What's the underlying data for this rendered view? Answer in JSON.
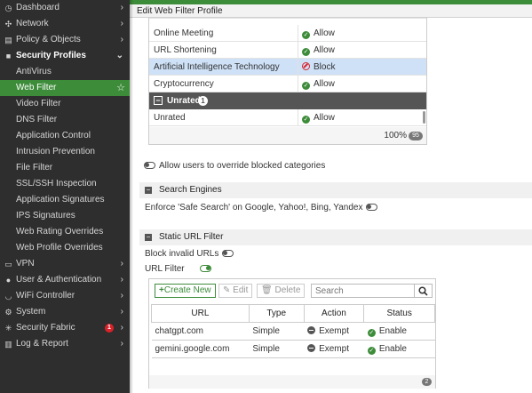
{
  "sidebar": {
    "items": [
      {
        "label": "Dashboard",
        "icon": "dashboard-icon",
        "glyph": "◷"
      },
      {
        "label": "Network",
        "icon": "network-icon",
        "glyph": "✣"
      },
      {
        "label": "Policy & Objects",
        "icon": "policy-icon",
        "glyph": "▤"
      },
      {
        "label": "Security Profiles",
        "icon": "lock-icon",
        "glyph": "🔒"
      },
      {
        "label": "AntiVirus"
      },
      {
        "label": "Web Filter"
      },
      {
        "label": "Video Filter"
      },
      {
        "label": "DNS Filter"
      },
      {
        "label": "Application Control"
      },
      {
        "label": "Intrusion Prevention"
      },
      {
        "label": "File Filter"
      },
      {
        "label": "SSL/SSH Inspection"
      },
      {
        "label": "Application Signatures"
      },
      {
        "label": "IPS Signatures"
      },
      {
        "label": "Web Rating Overrides"
      },
      {
        "label": "Web Profile Overrides"
      },
      {
        "label": "VPN",
        "icon": "vpn-icon",
        "glyph": "▭"
      },
      {
        "label": "User & Authentication",
        "icon": "user-icon",
        "glyph": "👤"
      },
      {
        "label": "WiFi Controller",
        "icon": "wifi-icon",
        "glyph": "◡"
      },
      {
        "label": "System",
        "icon": "gear-icon",
        "glyph": "⚙"
      },
      {
        "label": "Security Fabric",
        "icon": "fabric-icon",
        "glyph": "✳",
        "badge": "1"
      },
      {
        "label": "Log & Report",
        "icon": "chart-icon",
        "glyph": "▥"
      }
    ]
  },
  "header": {
    "title": "Edit Web Filter Profile"
  },
  "categories": {
    "rows": [
      {
        "name": "Online Meeting",
        "action": "Allow"
      },
      {
        "name": "URL Shortening",
        "action": "Allow"
      },
      {
        "name": "Artificial Intelligence Technology",
        "action": "Block"
      },
      {
        "name": "Cryptocurrency",
        "action": "Allow"
      }
    ],
    "group": {
      "name": "Unrated",
      "count": "1"
    },
    "unrated_row": {
      "name": "Unrated",
      "action": "Allow"
    },
    "footer_pct": "100%",
    "footer_badge": "95"
  },
  "override": {
    "label": "Allow users to override blocked categories"
  },
  "search_engines": {
    "title": "Search Engines",
    "safe_search": "Enforce 'Safe Search' on Google, Yahoo!, Bing, Yandex"
  },
  "static_url": {
    "title": "Static URL Filter",
    "block_invalid": "Block invalid URLs",
    "url_filter": "URL Filter",
    "toolbar": {
      "create": "Create New",
      "edit": "Edit",
      "delete": "Delete",
      "search_placeholder": "Search"
    },
    "columns": [
      "URL",
      "Type",
      "Action",
      "Status"
    ],
    "rows": [
      {
        "url": "chatgpt.com",
        "type": "Simple",
        "action": "Exempt",
        "status": "Enable"
      },
      {
        "url": "gemini.google.com",
        "type": "Simple",
        "action": "Exempt",
        "status": "Enable"
      }
    ],
    "count": "2"
  },
  "colors": {
    "accent": "#3d8c3a",
    "sidebar_bg": "#2e2e2e",
    "block": "#d9222a",
    "selected_row": "#cfe1f7"
  }
}
